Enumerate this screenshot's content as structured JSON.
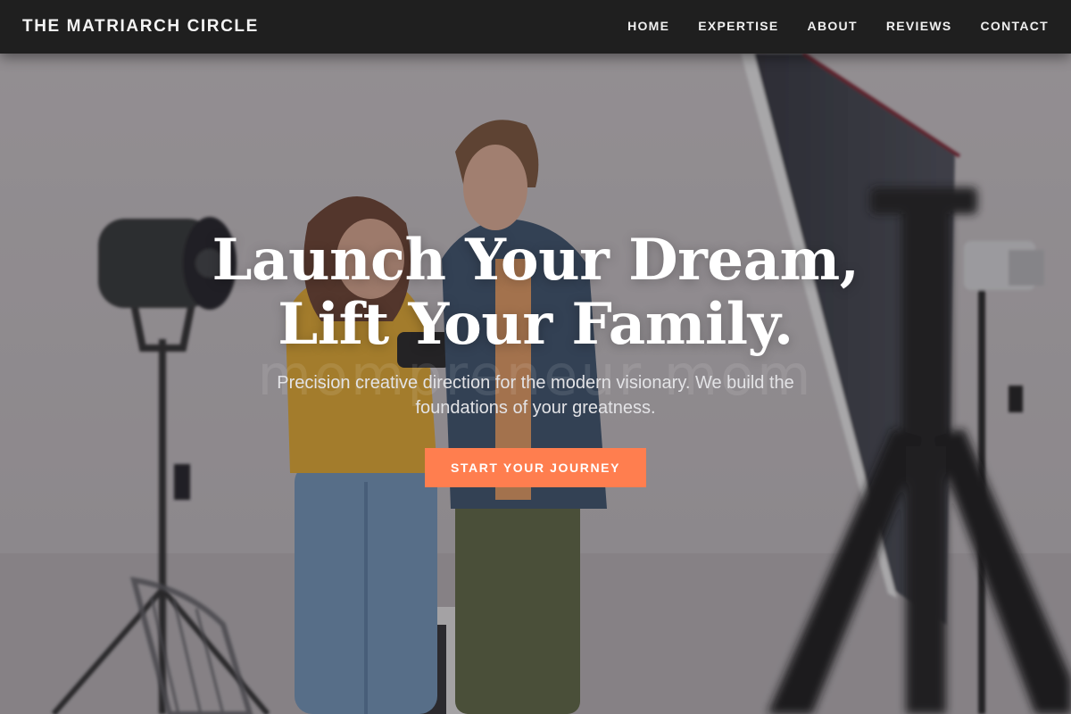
{
  "nav": {
    "brand": "THE MATRIARCH CIRCLE",
    "links": [
      "HOME",
      "EXPERTISE",
      "ABOUT",
      "REVIEWS",
      "CONTACT"
    ]
  },
  "hero": {
    "headline_line1": "Launch Your Dream,",
    "headline_line2": "Lift Your Family.",
    "watermark": "mompreneur mom",
    "subtext": "Precision creative direction for the modern visionary. We build the foundations of your greatness.",
    "cta_label": "START YOUR JOURNEY",
    "image_alt": "Two people looking at a camera in a photo studio with lights and tripods"
  },
  "colors": {
    "nav_bg": "#1f1f1f",
    "cta": "#ff7e4f",
    "text": "#ffffff"
  }
}
